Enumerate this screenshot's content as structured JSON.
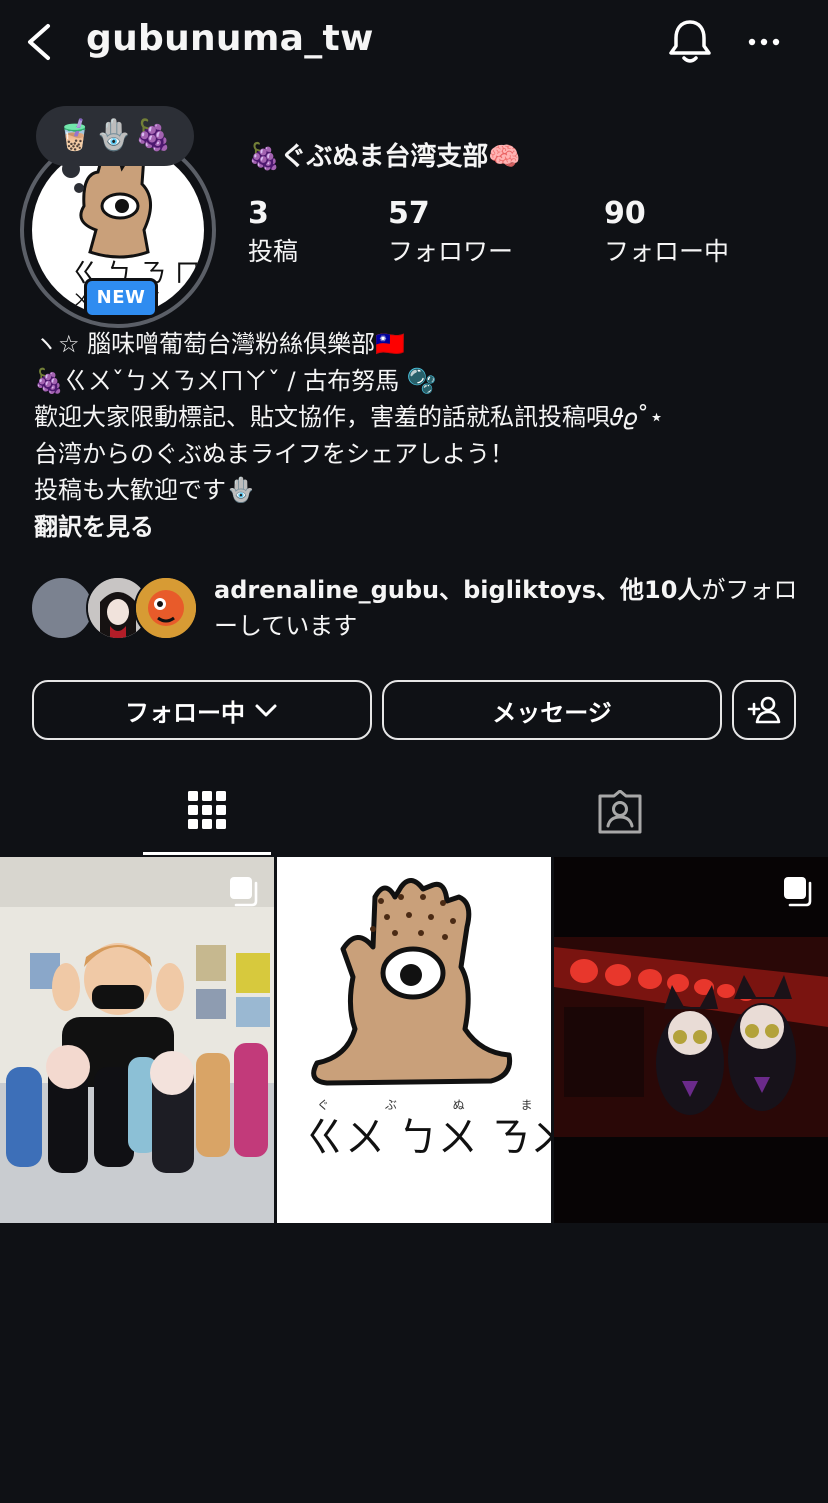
{
  "header": {
    "username": "gubunuma_tw",
    "back_icon": "chevron-left-icon",
    "bell_icon": "bell-icon",
    "more_icon": "more-horizontal-icon"
  },
  "profile": {
    "note_emojis": "🧋🪬🍇",
    "new_badge": "NEW",
    "display_name": "🍇ぐぶぬま台湾支部🧠",
    "stats": [
      {
        "value": "3",
        "label": "投稿"
      },
      {
        "value": "57",
        "label": "フォロワー"
      },
      {
        "value": "90",
        "label": "フォロー中"
      }
    ]
  },
  "bio": {
    "lines": [
      "ヽ☆ 腦味噌葡萄台灣粉絲俱樂部🇹🇼",
      "🍇ㄍㄨˇㄅㄨㄋㄨㄇㄚˇ / 古布努馬 🫧",
      "歡迎大家限動標記、貼文協作，害羞的話就私訊投稿唄𝜗𝜚˚⋆",
      "台湾からのぐぶぬまライフをシェアしよう！",
      "投稿も大歓迎です🪬"
    ],
    "translate": "翻訳を見る"
  },
  "followed_by": {
    "names": "adrenaline_gubu、bigliktoys、",
    "others": "他10人",
    "suffix": "がフォローしています"
  },
  "actions": {
    "following_label": "フォロー中",
    "message_label": "メッセージ",
    "add_person_icon": "add-person-icon"
  },
  "tabs": [
    {
      "name": "grid",
      "icon": "grid-icon",
      "active": true
    },
    {
      "name": "tagged",
      "icon": "tagged-person-icon",
      "active": false
    }
  ],
  "posts": [
    {
      "kind": "photo",
      "multi": true
    },
    {
      "kind": "illustration",
      "multi": false,
      "caption": "ㄍㄨ ㄅㄨ ㄋㄨ ㄇㄚ",
      "ruby": "ぐ ぶ ぬ ま"
    },
    {
      "kind": "photo",
      "multi": true
    }
  ],
  "colors": {
    "background": "#0f1115",
    "accent_badge": "#2f8cf0",
    "border": "#e6e6e6"
  }
}
